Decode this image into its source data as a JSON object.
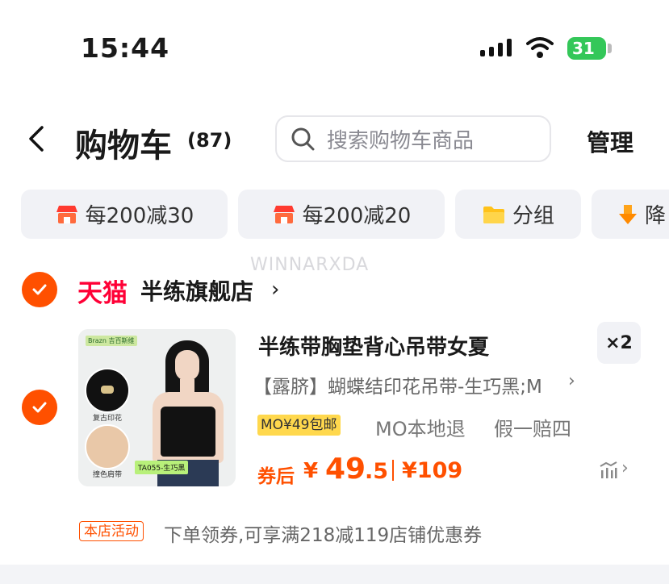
{
  "status_bar": {
    "time": "15:44",
    "battery": "31"
  },
  "header": {
    "title": "购物车",
    "count": "(87)",
    "search_placeholder": "搜索购物车商品",
    "manage": "管理"
  },
  "chips": [
    {
      "label": "每200减30",
      "icon": "store-icon"
    },
    {
      "label": "每200减20",
      "icon": "store-icon"
    },
    {
      "label": "分组",
      "icon": "folder-icon"
    },
    {
      "label": "降",
      "icon": "price-drop-icon"
    }
  ],
  "watermark": "WINNARXDA",
  "store": {
    "platform": "天猫",
    "name": "半练旗舰店"
  },
  "product": {
    "title": "半练带胸垫背心吊带女夏",
    "quantity": "×2",
    "spec": "【露脐】蝴蝶结印花吊带-生巧黑;M",
    "image": {
      "brand": "Brazn 吉百斯维",
      "label_1": "复古印花",
      "label_2": "撞色肩带",
      "sku": "TA055-生巧黑"
    },
    "shipping_badge": "MO¥49包邮",
    "tag_return": "MO本地退",
    "tag_guarantee": "假一赔四",
    "price_label": "券后",
    "price_currency": "¥",
    "price_int": "49",
    "price_dec": ".5",
    "original_price": "¥109"
  },
  "promo": {
    "badge": "本店活动",
    "text": "下单领券,可享满218减119店铺优惠券"
  },
  "colors": {
    "accent": "#ff5000",
    "tmall": "#ff0036",
    "chip_bg": "#f1f2f6",
    "badge_yellow": "#ffd84d"
  }
}
